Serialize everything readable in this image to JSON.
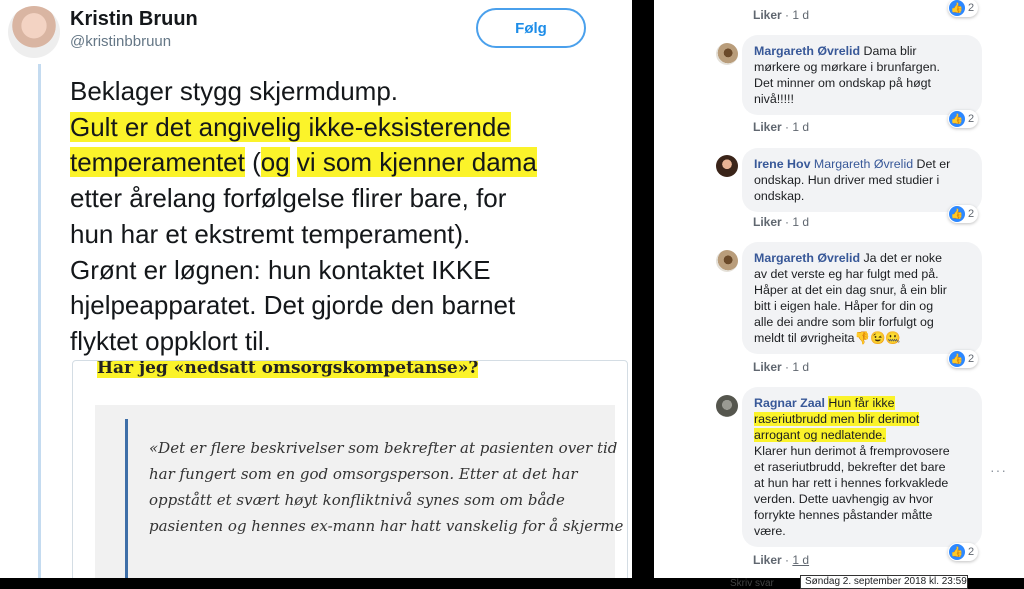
{
  "tweet": {
    "name": "Kristin Bruun",
    "handle": "@kristinbbruun",
    "follow_label": "Følg",
    "lines": [
      [
        {
          "t": "Beklager stygg skjermdump."
        }
      ],
      [
        {
          "t": "Gult er det angivelig ikke-eksisterende",
          "hl": true
        }
      ],
      [
        {
          "t": "temperamentet",
          "hl": true
        },
        {
          "t": " ("
        },
        {
          "t": "og",
          "hl": true
        },
        {
          "t": " "
        },
        {
          "t": "vi som kjenner dama",
          "hl": true
        }
      ],
      [
        {
          "t": "etter årelang forfølgelse flirer bare, for"
        }
      ],
      [
        {
          "t": "hun har et ekstremt temperament)."
        }
      ],
      [
        {
          "t": "Grønt er løgnen: hun kontaktet IKKE"
        }
      ],
      [
        {
          "t": "hjelpeapparatet. Det gjorde den barnet"
        }
      ],
      [
        {
          "t": "flyktet oppklort til."
        }
      ]
    ],
    "document": {
      "heading": "Har jeg «nedsatt omsorgskompetanse»?",
      "quote_lines": [
        "«Det er flere beskrivelser som bekrefter at pasienten over tid",
        "har fungert som en god omsorgsperson. Etter at det har",
        "oppstått et svært høyt konfliktnivå synes som om både",
        "pasienten og hennes ex-mann har hatt vanskelig for å skjerme"
      ]
    }
  },
  "facebook": {
    "top_meta": {
      "like": "Liker",
      "time": "1 d",
      "reactions": "2"
    },
    "comments": [
      {
        "author": "Margareth Øvrelid",
        "lines": [
          [
            {
              "b": "Margareth Øvrelid"
            },
            {
              "t": " Dama blir"
            }
          ],
          [
            {
              "t": "mørkere og mørkare i brunfargen."
            }
          ],
          [
            {
              "t": "Det minner om ondskap på høgt"
            }
          ],
          [
            {
              "t": "nivå!!!!!"
            }
          ]
        ],
        "like": "Liker",
        "time": "1 d",
        "reactions": "2"
      },
      {
        "author": "Irene Hov",
        "lines": [
          [
            {
              "b": "Irene Hov"
            },
            {
              "t": " "
            },
            {
              "tag": "Margareth Øvrelid"
            },
            {
              "t": " Det er"
            }
          ],
          [
            {
              "t": "ondskap. Hun driver med studier i"
            }
          ],
          [
            {
              "t": "ondskap."
            }
          ]
        ],
        "like": "Liker",
        "time": "1 d",
        "reactions": "2"
      },
      {
        "author": "Margareth Øvrelid",
        "lines": [
          [
            {
              "b": "Margareth Øvrelid"
            },
            {
              "t": " Ja det er noke"
            }
          ],
          [
            {
              "t": "av det verste eg har fulgt med på."
            }
          ],
          [
            {
              "t": "Håper at det ein dag snur, å ein blir"
            }
          ],
          [
            {
              "t": "bitt i eigen hale. Håper for din og"
            }
          ],
          [
            {
              "t": "alle dei andre som blir forfulgt og"
            }
          ],
          [
            {
              "t": "meldt til øvrigheita👎😉🤐"
            }
          ]
        ],
        "like": "Liker",
        "time": "1 d",
        "reactions": "2"
      },
      {
        "author": "Ragnar Zaal",
        "lines": [
          [
            {
              "b": "Ragnar Zaal"
            },
            {
              "t": " "
            },
            {
              "t": "Hun får ikke",
              "hl": true
            }
          ],
          [
            {
              "t": "raseriutbrudd men blir derimot",
              "hl": true
            }
          ],
          [
            {
              "t": "arrogant og nedlatende.",
              "hl": true
            }
          ],
          [
            {
              "t": "Klarer hun derimot å fremprovosere"
            }
          ],
          [
            {
              "t": "et raseriutbrudd, bekrefter det bare"
            }
          ],
          [
            {
              "t": "at hun har rett i hennes forkvaklede"
            }
          ],
          [
            {
              "t": "verden. Dette uavhengig av hvor"
            }
          ],
          [
            {
              "t": "forrykte hennes påstander måtte"
            }
          ],
          [
            {
              "t": "være."
            }
          ]
        ],
        "like": "Liker",
        "time": "1 d",
        "reactions": "2"
      }
    ],
    "more_label": "···",
    "tooltip": "Søndag 2. september 2018 kl. 23:59",
    "bottom_ghost": "Skriv svar"
  },
  "colors": {
    "highlight": "#fbf32a",
    "twitter_blue": "#1d8de8",
    "fb_link": "#385898",
    "like_blue": "#2d88ff"
  }
}
